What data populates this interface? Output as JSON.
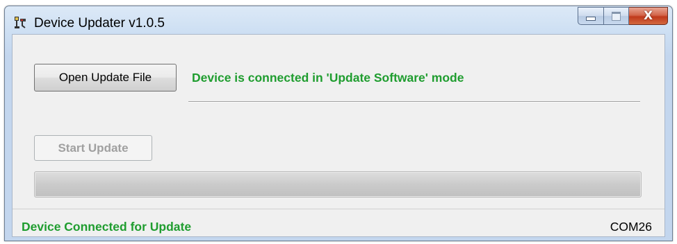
{
  "window": {
    "title": "Device Updater v1.0.5",
    "icon": "device-updater-app-icon",
    "caption_buttons": {
      "minimize_icon": "minimize-icon",
      "maximize_icon": "maximize-icon",
      "close_glyph": "X"
    }
  },
  "main": {
    "open_button_label": "Open Update File",
    "connection_message": "Device is connected in 'Update Software' mode",
    "start_button_label": "Start Update",
    "start_button_enabled": false,
    "progress": 0
  },
  "statusbar": {
    "status_text": "Device Connected for Update",
    "port": "COM26"
  },
  "colors": {
    "status_green": "#1f9d2f",
    "close_red": "#c0391c"
  }
}
